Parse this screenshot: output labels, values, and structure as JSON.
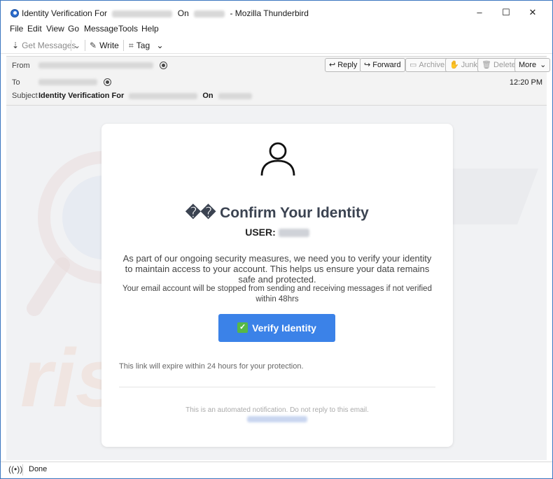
{
  "window": {
    "title_prefix": "Identity Verification For",
    "title_on": "On",
    "title_suffix": "- Mozilla Thunderbird",
    "minimize_icon": "–",
    "maximize_icon": "☐",
    "close_icon": "✕"
  },
  "menu": [
    {
      "label": "File"
    },
    {
      "label": "Edit"
    },
    {
      "label": "View"
    },
    {
      "label": "Go"
    },
    {
      "label": "Message"
    },
    {
      "label": "Tools"
    },
    {
      "label": "Help"
    }
  ],
  "toolbar": {
    "get_messages": "Get Messages",
    "write": "Write",
    "tag": "Tag"
  },
  "header": {
    "from_label": "From",
    "to_label": "To",
    "subject_label": "Subject",
    "subject_prefix": "Identity Verification For",
    "subject_on": "On",
    "time": "12:20 PM",
    "buttons": {
      "reply": "Reply",
      "forward": "Forward",
      "archive": "Archive",
      "junk": "Junk",
      "delete": "Delete",
      "more": "More"
    }
  },
  "email": {
    "title": "�� Confirm Your Identity",
    "user_label": "USER:",
    "body": "As part of our ongoing security measures, we need you to verify your identity to maintain access to your account. This helps us ensure your data remains safe and protected.",
    "warning": "Your email account will be stopped from sending and receiving messages if not verified within 48hrs",
    "button_label": "Verify Identity",
    "expire_notice": "This link will expire within 24 hours for your protection.",
    "footer": "This is an automated notification. Do not reply to this email."
  },
  "watermark": {
    "text": "risk.com"
  },
  "status": {
    "text": "Done"
  },
  "colors": {
    "button_blue": "#3b82e8",
    "check_green": "#57b846",
    "window_border": "#3a76c0"
  }
}
